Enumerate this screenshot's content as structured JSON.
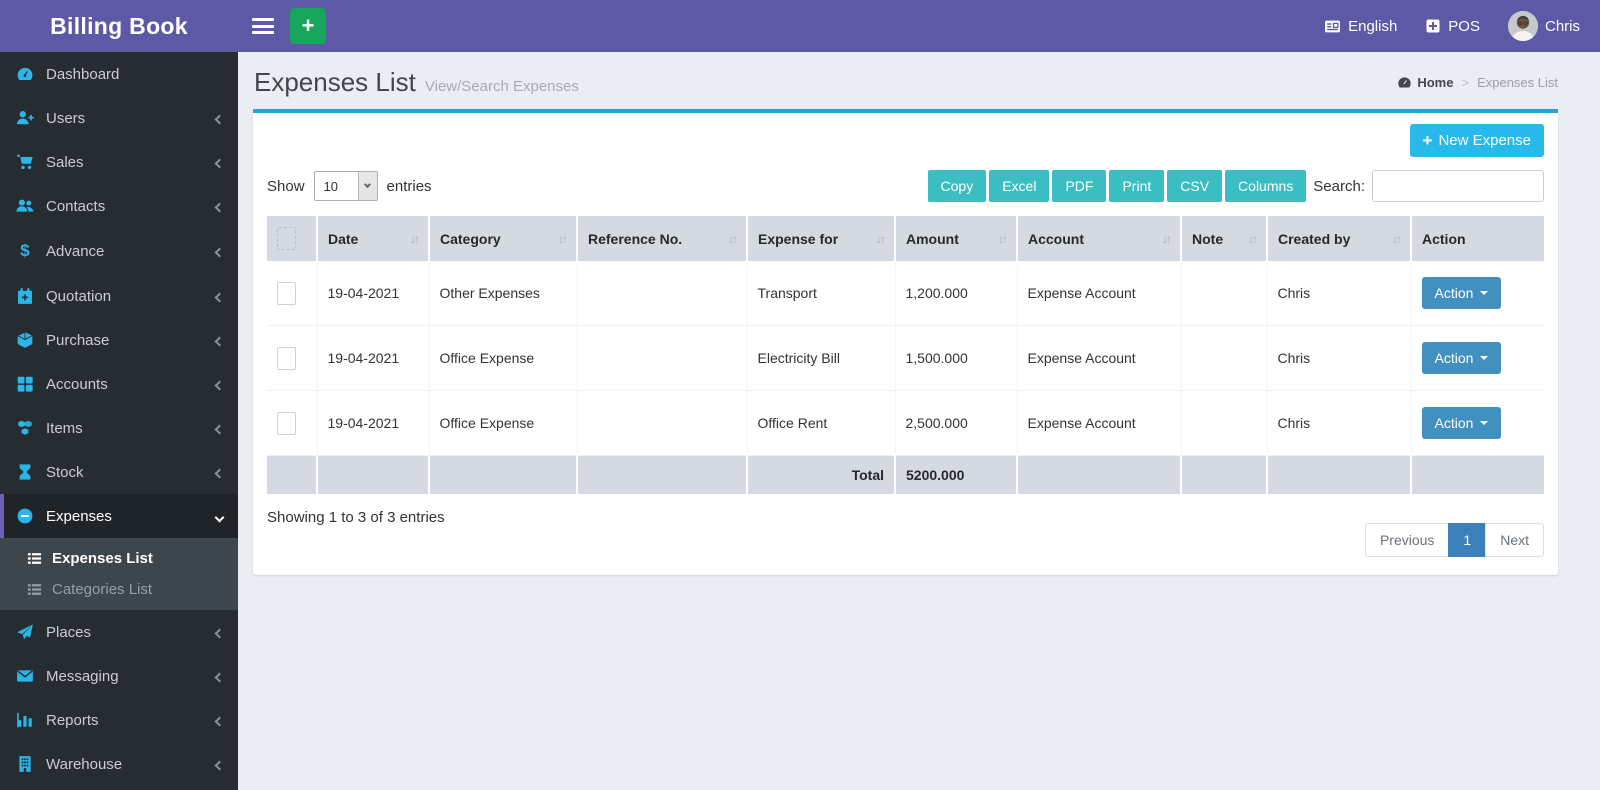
{
  "app": {
    "brand": "Billing Book"
  },
  "topbar": {
    "language": "English",
    "pos": "POS",
    "username": "Chris"
  },
  "page": {
    "title": "Expenses List",
    "subtitle": "View/Search Expenses",
    "breadcrumb_home": "Home",
    "breadcrumb_sep": ">",
    "breadcrumb_current": "Expenses List"
  },
  "sidebar": {
    "items": [
      {
        "label": "Dashboard",
        "icon": "speedometer-icon"
      },
      {
        "label": "Users",
        "icon": "user-plus-icon"
      },
      {
        "label": "Sales",
        "icon": "cart-icon"
      },
      {
        "label": "Contacts",
        "icon": "users-icon"
      },
      {
        "label": "Advance",
        "icon": "dollar-icon"
      },
      {
        "label": "Quotation",
        "icon": "calendar-plus-icon"
      },
      {
        "label": "Purchase",
        "icon": "cube-icon"
      },
      {
        "label": "Accounts",
        "icon": "grid-icon"
      },
      {
        "label": "Items",
        "icon": "cubes-icon"
      },
      {
        "label": "Stock",
        "icon": "hourglass-icon"
      },
      {
        "label": "Expenses",
        "icon": "minus-circle-icon",
        "state": "active-expanded"
      },
      {
        "label": "Places",
        "icon": "paper-plane-icon"
      },
      {
        "label": "Messaging",
        "icon": "envelope-icon"
      },
      {
        "label": "Reports",
        "icon": "bar-chart-icon"
      },
      {
        "label": "Warehouse",
        "icon": "building-icon"
      }
    ],
    "submenu": [
      {
        "label": "Expenses List",
        "state": "active"
      },
      {
        "label": "Categories List",
        "state": "normal"
      }
    ]
  },
  "toolbar": {
    "new_expense": "New Expense",
    "show_label": "Show",
    "page_length": "10",
    "entries_label": "entries",
    "search_label": "Search:",
    "search_value": "",
    "export_buttons": [
      "Copy",
      "Excel",
      "PDF",
      "Print",
      "CSV",
      "Columns"
    ]
  },
  "table": {
    "columns": [
      "Date",
      "Category",
      "Reference No.",
      "Expense for",
      "Amount",
      "Account",
      "Note",
      "Created by",
      "Action"
    ],
    "rows": [
      {
        "date": "19-04-2021",
        "category": "Other Expenses",
        "reference": "",
        "expense_for": "Transport",
        "amount": "1,200.000",
        "account": "Expense Account",
        "note": "",
        "created_by": "Chris",
        "action": "Action"
      },
      {
        "date": "19-04-2021",
        "category": "Office Expense",
        "reference": "",
        "expense_for": "Electricity Bill",
        "amount": "1,500.000",
        "account": "Expense Account",
        "note": "",
        "created_by": "Chris",
        "action": "Action"
      },
      {
        "date": "19-04-2021",
        "category": "Office Expense",
        "reference": "",
        "expense_for": "Office Rent",
        "amount": "2,500.000",
        "account": "Expense Account",
        "note": "",
        "created_by": "Chris",
        "action": "Action"
      }
    ],
    "footer": {
      "total_label": "Total",
      "total_amount": "5200.000"
    }
  },
  "pagination": {
    "info": "Showing 1 to 3 of 3 entries",
    "previous": "Previous",
    "current_page": "1",
    "next": "Next"
  },
  "colors": {
    "header_purple": "#5d59a6",
    "sidebar_dark": "#272c31",
    "accent_cyan": "#2cb5e8",
    "teal_button": "#3abec2",
    "new_expense_blue": "#28b8ea",
    "action_blue": "#4190c0",
    "card_top_border": "#2d9ed6",
    "green_button": "#18a55c",
    "pagination_active": "#3b80b9"
  }
}
